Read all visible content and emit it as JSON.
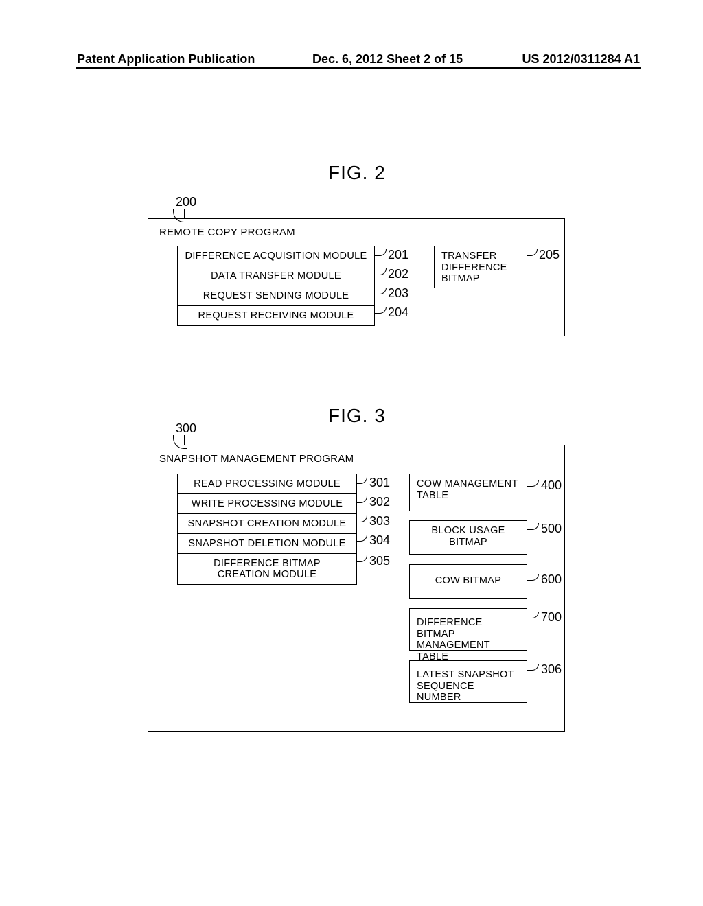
{
  "header": {
    "left": "Patent Application Publication",
    "mid": "Dec. 6, 2012   Sheet 2 of 15",
    "right": "US 2012/0311284 A1"
  },
  "fig2": {
    "title": "FIG. 2",
    "ref_program": "200",
    "program_title": "REMOTE COPY PROGRAM",
    "modules": [
      "DIFFERENCE ACQUISITION MODULE",
      "DATA TRANSFER MODULE",
      "REQUEST SENDING MODULE",
      "REQUEST RECEIVING MODULE"
    ],
    "module_refs": [
      "201",
      "202",
      "203",
      "204"
    ],
    "right_box": "TRANSFER\nDIFFERENCE\nBITMAP",
    "right_ref": "205"
  },
  "fig3": {
    "title": "FIG. 3",
    "ref_program": "300",
    "program_title": "SNAPSHOT MANAGEMENT PROGRAM",
    "modules": [
      "READ PROCESSING MODULE",
      "WRITE PROCESSING MODULE",
      "SNAPSHOT CREATION MODULE",
      "SNAPSHOT DELETION MODULE",
      "DIFFERENCE BITMAP\nCREATION MODULE"
    ],
    "module_refs": [
      "301",
      "302",
      "303",
      "304",
      "305"
    ],
    "right_boxes": [
      {
        "label": "COW MANAGEMENT\nTABLE",
        "ref": "400"
      },
      {
        "label": "BLOCK USAGE\nBITMAP",
        "ref": "500"
      },
      {
        "label": "COW BITMAP",
        "ref": "600"
      },
      {
        "label": "DIFFERENCE BITMAP\nMANAGEMENT TABLE",
        "ref": "700"
      },
      {
        "label": "LATEST SNAPSHOT\nSEQUENCE NUMBER",
        "ref": "306"
      }
    ]
  }
}
